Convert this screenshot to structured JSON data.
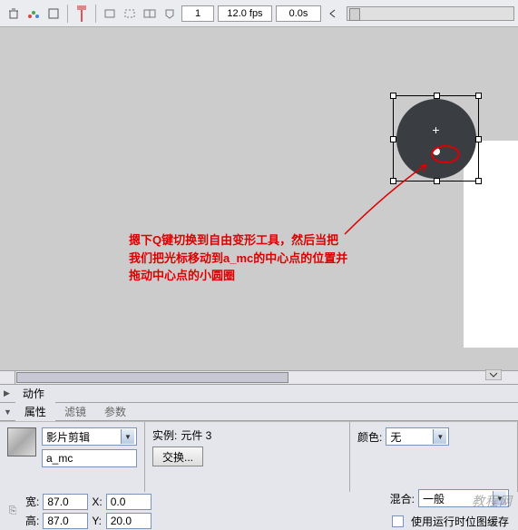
{
  "toolbar": {
    "frame": "1",
    "fps": "12.0 fps",
    "time": "0.0s"
  },
  "annotation": {
    "line1": "摁下Q键切换到自由变形工具，然后当把",
    "line2": "我们把光标移动到a_mc的中心点的位置并",
    "line3": "拖动中心点的小圆圈"
  },
  "panels": {
    "actions": "动作",
    "properties": "属性",
    "filters": "滤镜",
    "params": "参数"
  },
  "props": {
    "type": "影片剪辑",
    "instance_name": "a_mc",
    "instance_label": "实例:",
    "instance_value": "元件 3",
    "swap_btn": "交换...",
    "color_label": "颜色:",
    "color_value": "无",
    "blend_label": "混合:",
    "blend_value": "一般",
    "cache_label": "使用运行时位图缓存"
  },
  "dims": {
    "w_label": "宽:",
    "w_value": "87.0",
    "h_label": "高:",
    "h_value": "87.0",
    "x_label": "X:",
    "x_value": "0.0",
    "y_label": "Y:",
    "y_value": "20.0"
  },
  "watermark": "教程网"
}
